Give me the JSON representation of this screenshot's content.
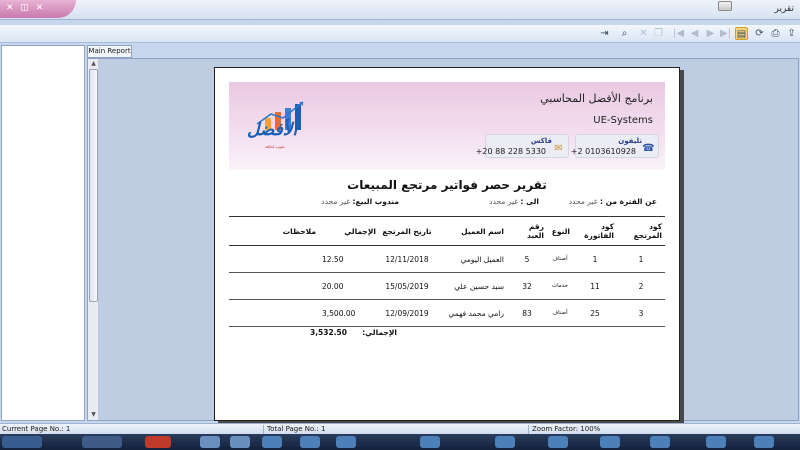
{
  "window": {
    "title": "تقرير"
  },
  "toolbar": {
    "icons": [
      "print-icon",
      "refresh-icon",
      "page-setup-icon",
      "export-icon",
      "first-page-icon",
      "prev-page-icon",
      "next-page-icon",
      "last-page-icon",
      "zoom-icon",
      "find-icon",
      "toggle-tree-icon"
    ]
  },
  "tab": {
    "label": "Main Report"
  },
  "report": {
    "company_name": "برنامج الأفضل المحاسبي",
    "company_en": "UE-Systems",
    "phone_label": "تليفون",
    "phone_value": "+2 0103610928",
    "fax_label": "فاكس",
    "fax_value": "+20 88 228 5330",
    "logo_text": "الأفضل",
    "logo_sub": "شوب لحافة",
    "title": "تقرير حصر فواتير مرتجع المبيعات",
    "filters": {
      "from_label": "عن الفترة من :",
      "from_value": "غير محدد",
      "to_label": "الى :",
      "to_value": "غير محدد",
      "rep_label": "مندوب البيع:",
      "rep_value": "غير محدد"
    },
    "columns": [
      "كود المرتجع",
      "كود الفاتورة",
      "النوع",
      "رقم العبد",
      "اسم العميل",
      "تاريخ المرتجع",
      "الإجمالي",
      "ملاحظات"
    ],
    "rows": [
      {
        "return_code": "1",
        "invoice_code": "1",
        "type": "أصناف",
        "customer_no": "5",
        "customer": "العميل اليومي",
        "date": "12/11/2018",
        "total": "12.50",
        "notes": ""
      },
      {
        "return_code": "2",
        "invoice_code": "11",
        "type": "خدمات",
        "customer_no": "32",
        "customer": "سيد حسين علي",
        "date": "15/05/2019",
        "total": "20.00",
        "notes": ""
      },
      {
        "return_code": "3",
        "invoice_code": "25",
        "type": "أصناف",
        "customer_no": "83",
        "customer": "رامي محمد فهمي",
        "date": "12/09/2019",
        "total": "3,500.00",
        "notes": ""
      }
    ],
    "total_label": "الإجمالي:",
    "total_value": "3,532.50"
  },
  "status": {
    "current_page": "Current Page No.: 1",
    "total_page": "Total Page No.: 1",
    "zoom": "Zoom Factor: 100%"
  }
}
